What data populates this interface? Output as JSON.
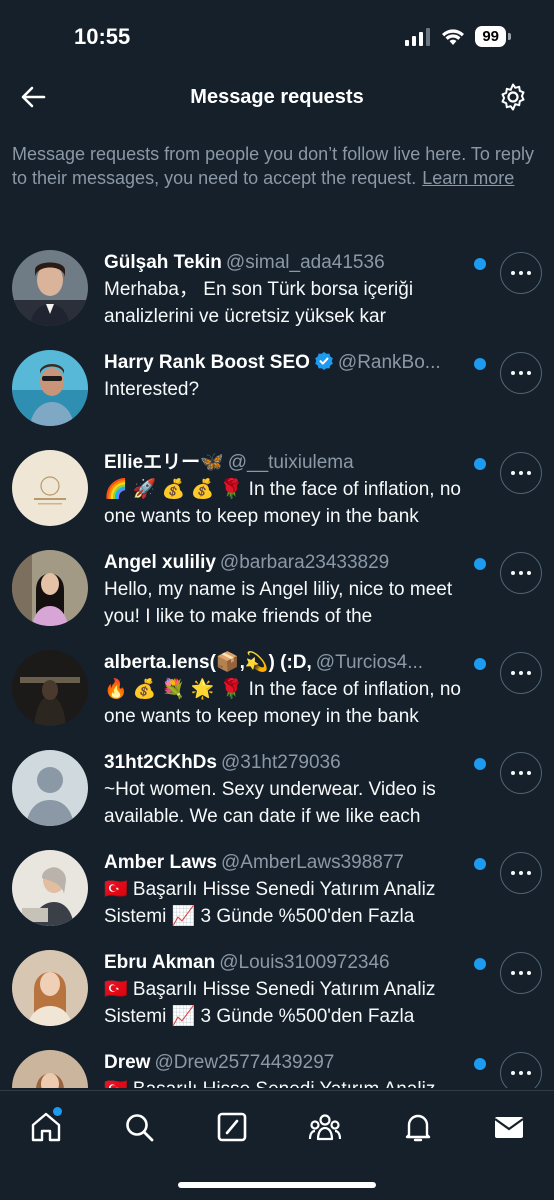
{
  "status_bar": {
    "time": "10:55",
    "battery": "99"
  },
  "header": {
    "title": "Message requests"
  },
  "info": {
    "text": "Message requests from people you don’t follow live here. To reply to their messages, you need to accept the request.",
    "link": "Learn more"
  },
  "requests": [
    {
      "name": "Gülşah Tekin",
      "handle": "@simal_ada41536",
      "message": "Merhaba， En son Türk borsa içeriği analizlerini ve ücretsiz yüksek kar",
      "unread": true,
      "verified": false
    },
    {
      "name": "Harry Rank Boost SEO",
      "handle": "@RankBo...",
      "message": "Interested?",
      "unread": true,
      "verified": true
    },
    {
      "name": "Ellieエリー🦋",
      "handle": "@__tuixiulema",
      "message": "🌈 🚀 💰 💰 🌹 In the face of inflation, no one wants to keep money in the bank",
      "unread": true,
      "verified": false
    },
    {
      "name": "Angel xuliliy",
      "handle": "@barbara23433829",
      "message": "Hello, my name is Angel liliy, nice to meet you! I like to make friends of the",
      "unread": true,
      "verified": false
    },
    {
      "name": "alberta.lens(📦,💫) (:D,",
      "handle": "@Turcios4...",
      "message": "🔥 💰 💐 🌟 🌹 In the face of inflation, no one wants to keep money in the bank",
      "unread": true,
      "verified": false
    },
    {
      "name": "31ht2CKhDs",
      "handle": "@31ht279036",
      "message": "~Hot women. Sexy underwear. Video is available. We can date if we like each",
      "unread": true,
      "verified": false
    },
    {
      "name": "Amber Laws",
      "handle": "@AmberLaws398877",
      "message": "🇹🇷 Başarılı Hisse Senedi Yatırım Analiz Sistemi 📈 3 Günde %500'den Fazla",
      "unread": true,
      "verified": false
    },
    {
      "name": "Ebru Akman",
      "handle": "@Louis3100972346",
      "message": "🇹🇷 Başarılı Hisse Senedi Yatırım Analiz Sistemi 📈 3 Günde %500'den Fazla",
      "unread": true,
      "verified": false
    },
    {
      "name": "Drew",
      "handle": "@Drew25774439297",
      "message": "🇹🇷 Başarılı Hisse Senedi Yatırım Analiz",
      "unread": true,
      "verified": false
    }
  ],
  "nav": {
    "items": [
      "home-icon",
      "search-icon",
      "grok-icon",
      "communities-icon",
      "notifications-icon",
      "messages-icon"
    ]
  },
  "colors": {
    "background": "#15202b",
    "accent": "#1d9bf0",
    "muted": "#8b98a5"
  }
}
